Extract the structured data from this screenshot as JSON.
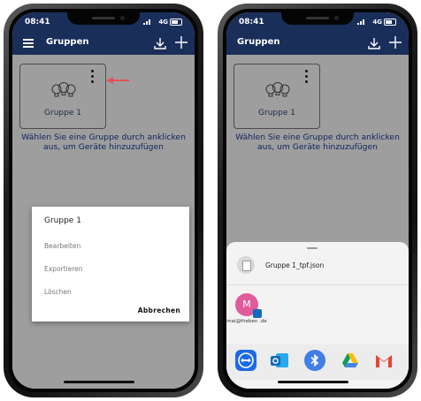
{
  "left_phone": {
    "status": {
      "time": "08:41",
      "network": "4G"
    },
    "appbar": {
      "title": "Gruppen"
    },
    "group_card": {
      "label": "Gruppe 1"
    },
    "hint": "Wählen Sie eine Gruppe durch anklicken aus, um Geräte hinzuzufügen",
    "dialog": {
      "title": "Gruppe 1",
      "options": [
        "Bearbeiten",
        "Exportieren",
        "Löschen"
      ],
      "cancel": "Abbrechen"
    },
    "colors": {
      "appbar": "#1a2e5a",
      "background": "#9e9e9e",
      "arrow": "#e8505b"
    }
  },
  "right_phone": {
    "status": {
      "time": "08:41",
      "network": "4G"
    },
    "appbar": {
      "title": "Gruppen"
    },
    "group_card": {
      "label": "Gruppe 1"
    },
    "hint": "Wählen Sie eine Gruppe durch anklicken aus, um Geräte hinzuzufügen",
    "share_sheet": {
      "file_name": "Gruppe 1_tpf.json",
      "contact": {
        "initial": "M",
        "name": "mai@theben .de"
      },
      "apps": [
        "teamviewer-icon",
        "outlook-icon",
        "bluetooth-icon",
        "google-drive-icon",
        "gmail-icon"
      ]
    }
  }
}
